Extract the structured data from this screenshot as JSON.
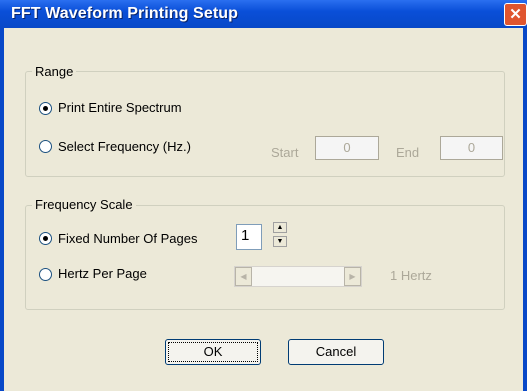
{
  "window": {
    "title": "FFT Waveform Printing Setup",
    "close_glyph": "✕"
  },
  "range": {
    "legend": "Range",
    "print_entire_label": "Print Entire Spectrum",
    "select_freq_label": "Select Frequency (Hz.)",
    "start_label": "Start",
    "start_value": "0",
    "end_label": "End",
    "end_value": "0"
  },
  "scale": {
    "legend": "Frequency Scale",
    "fixed_pages_label": "Fixed Number Of Pages",
    "pages_value": "1",
    "hertz_per_page_label": "Hertz Per Page",
    "hertz_value_label": "1 Hertz"
  },
  "buttons": {
    "ok_label": "OK",
    "cancel_label": "Cancel"
  },
  "colors": {
    "titlebar": "#0a4fd8",
    "close": "#e0552f",
    "dialog_bg": "#ece9d8"
  }
}
